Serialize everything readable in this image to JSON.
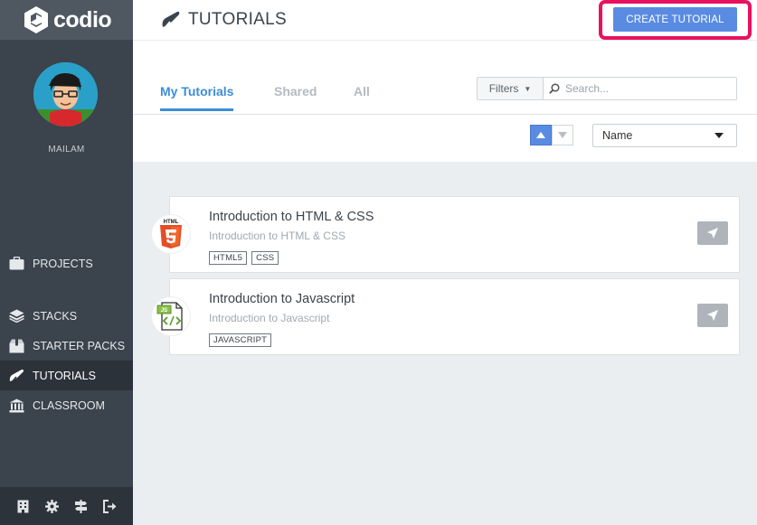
{
  "app": {
    "brand": "codio",
    "accent_color": "#5a8be2",
    "highlight_color": "#e8115f"
  },
  "sidebar": {
    "username": "MAILAM",
    "items": [
      {
        "label": "PROJECTS",
        "icon": "briefcase-icon"
      },
      {
        "label": "STACKS",
        "icon": "layers-icon"
      },
      {
        "label": "STARTER PACKS",
        "icon": "package-icon"
      },
      {
        "label": "TUTORIALS",
        "icon": "tutorial-icon",
        "active": true
      },
      {
        "label": "CLASSROOM",
        "icon": "bank-icon"
      }
    ],
    "footer_icons": [
      "building-icon",
      "gear-icon",
      "signpost-icon",
      "logout-icon"
    ]
  },
  "header": {
    "title": "TUTORIALS",
    "create_button": "CREATE TUTORIAL"
  },
  "tabs": [
    {
      "label": "My Tutorials",
      "active": true
    },
    {
      "label": "Shared"
    },
    {
      "label": "All"
    }
  ],
  "filters": {
    "label": "Filters",
    "search_placeholder": "Search..."
  },
  "sort": {
    "direction": "ascending",
    "field": "Name"
  },
  "tutorials": [
    {
      "title": "Introduction to HTML & CSS",
      "subtitle": "Introduction to HTML & CSS",
      "tags": [
        "HTML5",
        "CSS"
      ],
      "logo": "html5-icon"
    },
    {
      "title": "Introduction to Javascript",
      "subtitle": "Introduction to Javascript",
      "tags": [
        "JAVASCRIPT"
      ],
      "logo": "javascript-file-icon"
    }
  ]
}
